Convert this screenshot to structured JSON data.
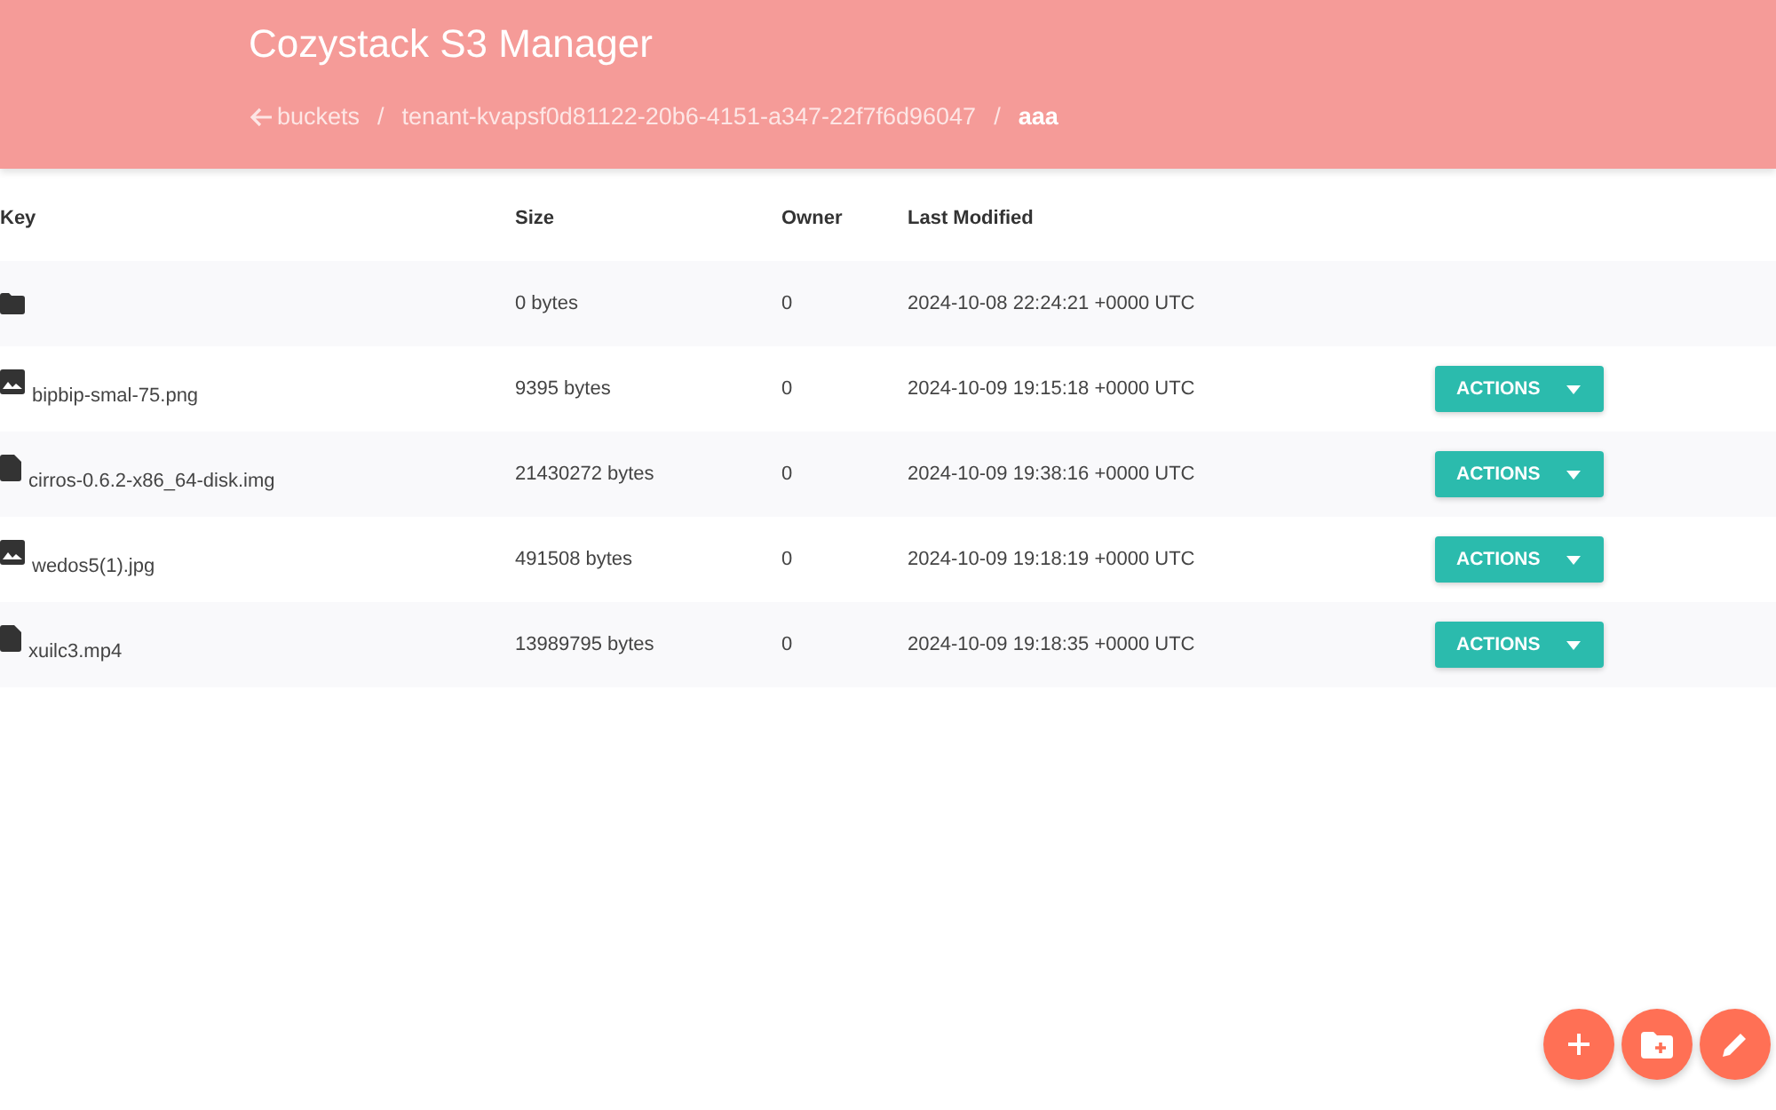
{
  "header": {
    "title": "Cozystack S3 Manager",
    "breadcrumbs": [
      {
        "label": "buckets",
        "kind": "back"
      },
      {
        "separator": "/",
        "label": "tenant-kvapsf0d81122-20b6-4151-a347-22f7f6d96047",
        "kind": "link"
      },
      {
        "separator": "/",
        "label": "aaa",
        "kind": "current"
      }
    ]
  },
  "table": {
    "columns": [
      "Key",
      "Size",
      "Owner",
      "Last Modified"
    ],
    "rows": [
      {
        "kind": "folder",
        "key": "",
        "size": "0 bytes",
        "owner": "0",
        "modified": "2024-10-08 22:24:21 +0000 UTC"
      },
      {
        "kind": "image",
        "key": "bipbip-smal-75.png",
        "size": "9395 bytes",
        "owner": "0",
        "modified": "2024-10-09 19:15:18 +0000 UTC",
        "action": "ACTIONS"
      },
      {
        "kind": "file",
        "key": "cirros-0.6.2-x86_64-disk.img",
        "size": "21430272 bytes",
        "owner": "0",
        "modified": "2024-10-09 19:38:16 +0000 UTC",
        "action": "ACTIONS"
      },
      {
        "kind": "image",
        "key": "wedos5(1).jpg",
        "size": "491508 bytes",
        "owner": "0",
        "modified": "2024-10-09 19:18:19 +0000 UTC",
        "action": "ACTIONS"
      },
      {
        "kind": "file",
        "key": "xuilc3.mp4",
        "size": "13989795 bytes",
        "owner": "0",
        "modified": "2024-10-09 19:18:35 +0000 UTC",
        "action": "ACTIONS"
      }
    ]
  },
  "fabs": [
    {
      "kind": "add"
    },
    {
      "kind": "new-folder"
    },
    {
      "kind": "edit"
    }
  ]
}
